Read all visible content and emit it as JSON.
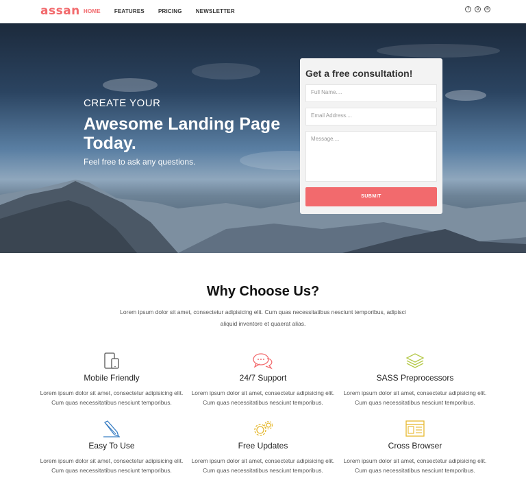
{
  "nav": {
    "logo": "assan",
    "menu": [
      "HOME",
      "FEATURES",
      "PRICING",
      "NEWSLETTER"
    ],
    "active_index": 0,
    "socials": [
      "facebook-icon",
      "google-plus-icon",
      "linkedin-icon"
    ]
  },
  "hero": {
    "pretitle": "CREATE YOUR",
    "title": "Awesome Landing Page Today.",
    "subtitle": "Feel free to ask any questions."
  },
  "form": {
    "title": "Get a free consultation!",
    "name_placeholder": "Full Name....",
    "email_placeholder": "Email Address....",
    "message_placeholder": "Message....",
    "submit_label": "SUBMIT"
  },
  "why": {
    "title": "Why Choose Us?",
    "description": "Lorem ipsum dolor sit amet, consectetur adipisicing elit. Cum quas necessitatibus nesciunt temporibus, adipisci aliquid inventore et quaerat alias."
  },
  "features": [
    {
      "icon": "tablet-icon",
      "title": "Mobile Friendly",
      "desc": "Lorem ipsum dolor sit amet, consectetur adipisicing elit. Cum quas necessitatibus nesciunt temporibus."
    },
    {
      "icon": "chat-icon",
      "title": "24/7 Support",
      "desc": "Lorem ipsum dolor sit amet, consectetur adipisicing elit. Cum quas necessitatibus nesciunt temporibus."
    },
    {
      "icon": "layers-icon",
      "title": "SASS Preprocessors",
      "desc": "Lorem ipsum dolor sit amet, consectetur adipisicing elit. Cum quas necessitatibus nesciunt temporibus."
    },
    {
      "icon": "pencil-icon",
      "title": "Easy To Use",
      "desc": "Lorem ipsum dolor sit amet, consectetur adipisicing elit. Cum quas necessitatibus nesciunt temporibus."
    },
    {
      "icon": "gears-icon",
      "title": "Free Updates",
      "desc": "Lorem ipsum dolor sit amet, consectetur adipisicing elit. Cum quas necessitatibus nesciunt temporibus."
    },
    {
      "icon": "browser-icon",
      "title": "Cross Browser",
      "desc": "Lorem ipsum dolor sit amet, consectetur adipisicing elit. Cum quas necessitatibus nesciunt temporibus."
    }
  ],
  "colors": {
    "accent": "#f26a6d",
    "icon_gray": "#555555",
    "icon_red": "#f26a6d",
    "icon_green": "#b5c94a",
    "icon_blue": "#3b7fc4",
    "icon_yellow": "#e6b82e"
  }
}
